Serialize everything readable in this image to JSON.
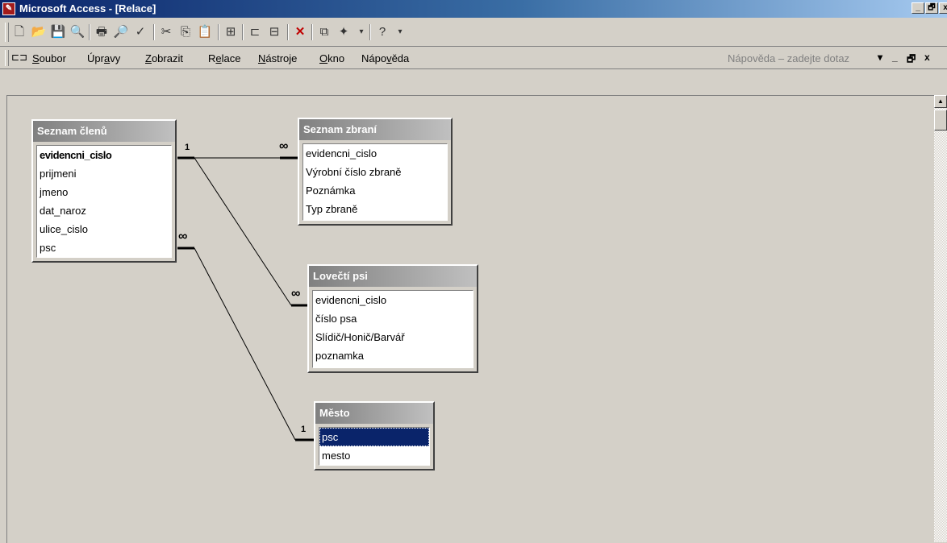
{
  "window": {
    "title": "Microsoft Access - [Relace]"
  },
  "window_controls": {
    "minimize": "_",
    "restore": "🗗",
    "close": "x"
  },
  "toolbar_icons": [
    "new-icon",
    "open-icon",
    "save-icon",
    "search-icon",
    "print-icon",
    "print-preview-icon",
    "spelling-icon",
    "cut-icon",
    "copy-icon",
    "paste-icon",
    "show-table-icon",
    "direct-relationships-icon",
    "all-relationships-icon",
    "delete-icon",
    "database-window-icon",
    "new-object-icon",
    "help-icon"
  ],
  "menu": {
    "items": [
      {
        "pre": "",
        "u": "S",
        "post": "oubor"
      },
      {
        "pre": "Úpr",
        "u": "a",
        "post": "vy"
      },
      {
        "pre": "",
        "u": "Z",
        "post": "obrazit"
      },
      {
        "pre": "R",
        "u": "e",
        "post": "lace"
      },
      {
        "pre": "",
        "u": "N",
        "post": "ástroje"
      },
      {
        "pre": "",
        "u": "O",
        "post": "kno"
      },
      {
        "pre": "Nápo",
        "u": "v",
        "post": "ěda"
      }
    ],
    "help_placeholder": "Nápověda – zadejte dotaz"
  },
  "tables": {
    "clenove": {
      "title": "Seznam členů",
      "fields": [
        "evidencni_cislo",
        "prijmeni",
        "jmeno",
        "dat_naroz",
        "ulice_cislo",
        "psc"
      ]
    },
    "zbrane": {
      "title": "Seznam zbraní",
      "fields": [
        "evidencni_cislo",
        "Výrobní číslo zbraně",
        "Poznámka",
        "Typ zbraně"
      ]
    },
    "psi": {
      "title": "Lovečtí psi",
      "fields": [
        "evidencni_cislo",
        "číslo psa",
        "Slídič/Honič/Barvář",
        "poznamka"
      ]
    },
    "mesto": {
      "title": "Město",
      "fields": [
        "psc",
        "mesto"
      ]
    }
  },
  "relations": {
    "one": "1",
    "many": "∞"
  }
}
